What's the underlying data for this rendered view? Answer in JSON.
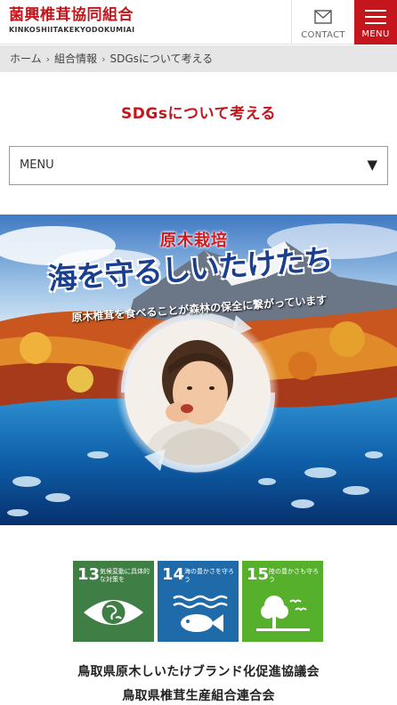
{
  "header": {
    "logo_jp": "菌興椎茸協同組合",
    "logo_en": "KINKOSHIITAKEKYODOKUMIAI",
    "contact_label": "CONTACT",
    "menu_label": "MENU",
    "brand_color": "#c4161c"
  },
  "breadcrumb": {
    "items": [
      "ホーム",
      "組合情報",
      "SDGsについて考える"
    ],
    "separator": "›"
  },
  "page": {
    "title": "SDGsについて考える"
  },
  "menu_select": {
    "label": "MENU",
    "arrow": "▼"
  },
  "banner": {
    "tag": "原木栽培",
    "headline": "海を守るしいたけたち",
    "subline": "原木椎茸を食べることが森林の保全に繋がっています"
  },
  "sdg_goals": [
    {
      "number": "13",
      "text": "気候変動に具体的な対策を",
      "color": "#3f7e44",
      "icon": "eye-globe-icon"
    },
    {
      "number": "14",
      "text": "海の豊かさを守ろう",
      "color": "#0a97d9",
      "icon": "fish-waves-icon"
    },
    {
      "number": "15",
      "text": "陸の豊かさも守ろう",
      "color": "#56c02b",
      "icon": "tree-birds-icon"
    }
  ],
  "organizations": [
    "鳥取県原木しいたけブランド化促進協議会",
    "鳥取県椎茸生産組合連合会"
  ]
}
